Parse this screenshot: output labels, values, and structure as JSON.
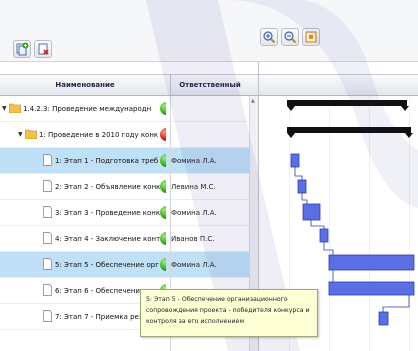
{
  "columns": {
    "name": "Наименование",
    "responsible": "Ответственный"
  },
  "rows": [
    {
      "name": "1.4.2.3: Проведение международн",
      "responsible": "",
      "status": "green",
      "kind": "folder",
      "level": 0
    },
    {
      "name": "1: Проведение в 2010 году конк",
      "responsible": "",
      "status": "red",
      "kind": "folder",
      "level": 1
    },
    {
      "name": "1: Этап 1 - Подготовка треб",
      "responsible": "Фомина Л.А.",
      "status": "green",
      "kind": "doc",
      "level": 2
    },
    {
      "name": "2: Этап 2 - Объявление конк",
      "responsible": "Левина М.С.",
      "status": "green",
      "kind": "doc",
      "level": 2
    },
    {
      "name": "3: Этап 3 - Проведение конк",
      "responsible": "Фомина Л.А.",
      "status": "green",
      "kind": "doc",
      "level": 2
    },
    {
      "name": "4: Этап 4 - Заключение конт",
      "responsible": "Иванов П.С.",
      "status": "green",
      "kind": "doc",
      "level": 2
    },
    {
      "name": "5: Этап 5 - Обеспечение орг",
      "responsible": "Фомина Л.А.",
      "status": "green",
      "kind": "doc",
      "level": 2
    },
    {
      "name": "6: Этап 6 - Обеспечение",
      "responsible": "",
      "status": "green",
      "kind": "doc",
      "level": 2
    },
    {
      "name": "7: Этап 7 - Приемка резу",
      "responsible": "",
      "status": "green",
      "kind": "doc",
      "level": 2
    }
  ],
  "selected_rows": [
    2,
    6
  ],
  "tooltip": {
    "line1": "5: Этап 5 - Обеспечение организационного",
    "line2": "сопровождения проекта - победителя конкурса и",
    "line3": "контроля за его исполнением"
  },
  "toolbar_icons": [
    "add-task-icon",
    "delete-task-icon",
    "zoom-in-icon",
    "zoom-out-icon",
    "fit-icon"
  ],
  "colors": {
    "selection": "#bfe0f6",
    "task_bar": "#4d63e0",
    "summary_bar": "#111111",
    "watermark": "#3e3d9c"
  }
}
